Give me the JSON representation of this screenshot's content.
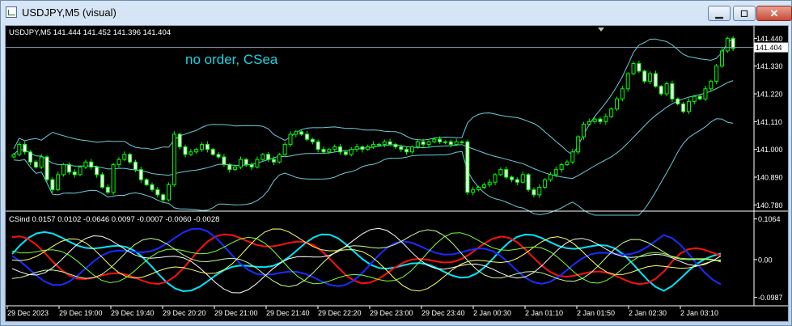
{
  "window": {
    "title": "USDJPY,M5 (visual)",
    "minimize_glyph": "▁",
    "maximize_glyph": "◻",
    "close_glyph": "✕"
  },
  "main_panel": {
    "header": "USDJPY,M5  141.444 141.452 141.396 141.404",
    "comment": "no order, CSea"
  },
  "indicator_panel": {
    "header": "CSind 0.0157 0.0102 -0.0646 0.0097 -0.0007 -0.0060 -0.0028"
  },
  "time_axis_labels": [
    "29 Dec 2023",
    "29 Dec 19:00",
    "29 Dec 19:40",
    "29 Dec 20:20",
    "29 Dec 21:00",
    "29 Dec 21:40",
    "29 Dec 22:20",
    "29 Dec 23:00",
    "29 Dec 23:40",
    "2 Jan 00:30",
    "2 Jan 01:10",
    "2 Jan 01:50",
    "2 Jan 02:30",
    "2 Jan 03:10"
  ],
  "colors": {
    "background": "#000000",
    "candle": "#00ff00",
    "bollinger": "#7ff0ff",
    "comment": "#1fd3e0",
    "axis_text": "#ffffff",
    "current_price_line": "#8aa6b8"
  },
  "chart_data": {
    "type": "candlestick",
    "symbol": "USDJPY",
    "timeframe": "M5",
    "price_axis": {
      "ticks": [
        141.44,
        141.33,
        141.22,
        141.11,
        141.0,
        140.89,
        140.78
      ],
      "tick_labels": [
        "141.440",
        "141.330",
        "141.220",
        "141.110",
        "141.000",
        "140.890",
        "140.780"
      ],
      "ylim": [
        140.765,
        141.47
      ],
      "current_price": 141.404,
      "current_price_label": "141.404"
    },
    "close_series": [
      140.98,
      141.02,
      140.99,
      140.95,
      140.93,
      140.97,
      140.88,
      140.84,
      140.9,
      140.94,
      140.91,
      140.9,
      140.93,
      140.95,
      140.93,
      140.9,
      140.85,
      140.83,
      140.94,
      140.96,
      140.98,
      140.95,
      140.92,
      140.88,
      140.86,
      140.84,
      140.82,
      140.8,
      140.86,
      141.06,
      141.01,
      140.98,
      140.99,
      141.0,
      141.02,
      141.0,
      140.98,
      140.97,
      140.94,
      140.92,
      140.93,
      140.96,
      140.94,
      140.93,
      140.96,
      140.98,
      140.96,
      140.95,
      140.98,
      141.02,
      141.06,
      141.07,
      141.06,
      141.04,
      141.03,
      141.0,
      140.99,
      141.0,
      141.01,
      140.99,
      140.98,
      141.0,
      141.01,
      141.0,
      141.01,
      141.02,
      141.02,
      141.03,
      141.02,
      141.01,
      141.0,
      140.99,
      141.01,
      141.03,
      141.02,
      141.03,
      141.04,
      141.03,
      141.03,
      141.02,
      141.03,
      141.03,
      140.83,
      140.84,
      140.85,
      140.86,
      140.87,
      140.9,
      140.92,
      140.89,
      140.88,
      140.87,
      140.9,
      140.84,
      140.82,
      140.85,
      140.88,
      140.9,
      140.92,
      140.94,
      140.95,
      140.99,
      141.05,
      141.1,
      141.11,
      141.12,
      141.11,
      141.13,
      141.16,
      141.2,
      141.24,
      141.3,
      141.34,
      141.31,
      141.27,
      141.3,
      141.25,
      141.22,
      141.26,
      141.2,
      141.18,
      141.15,
      141.19,
      141.21,
      141.2,
      141.24,
      141.27,
      141.33,
      141.39,
      141.44,
      141.4
    ],
    "indicator": {
      "name": "CSind",
      "ticks": [
        0.1064,
        0.0,
        -0.0987
      ],
      "tick_labels": [
        "0.1064",
        "0.00",
        "-0.0987"
      ],
      "ylim": [
        -0.108,
        0.112
      ],
      "values": [
        0.0157,
        0.0102,
        -0.0646,
        0.0097,
        -0.0007,
        -0.006,
        -0.0028
      ],
      "series_colors": [
        "#00e5ff",
        "#ff1010",
        "#1a2cff",
        "#ffffff",
        "#ffff66",
        "#7cff3a",
        "#c8ff9a"
      ]
    }
  }
}
